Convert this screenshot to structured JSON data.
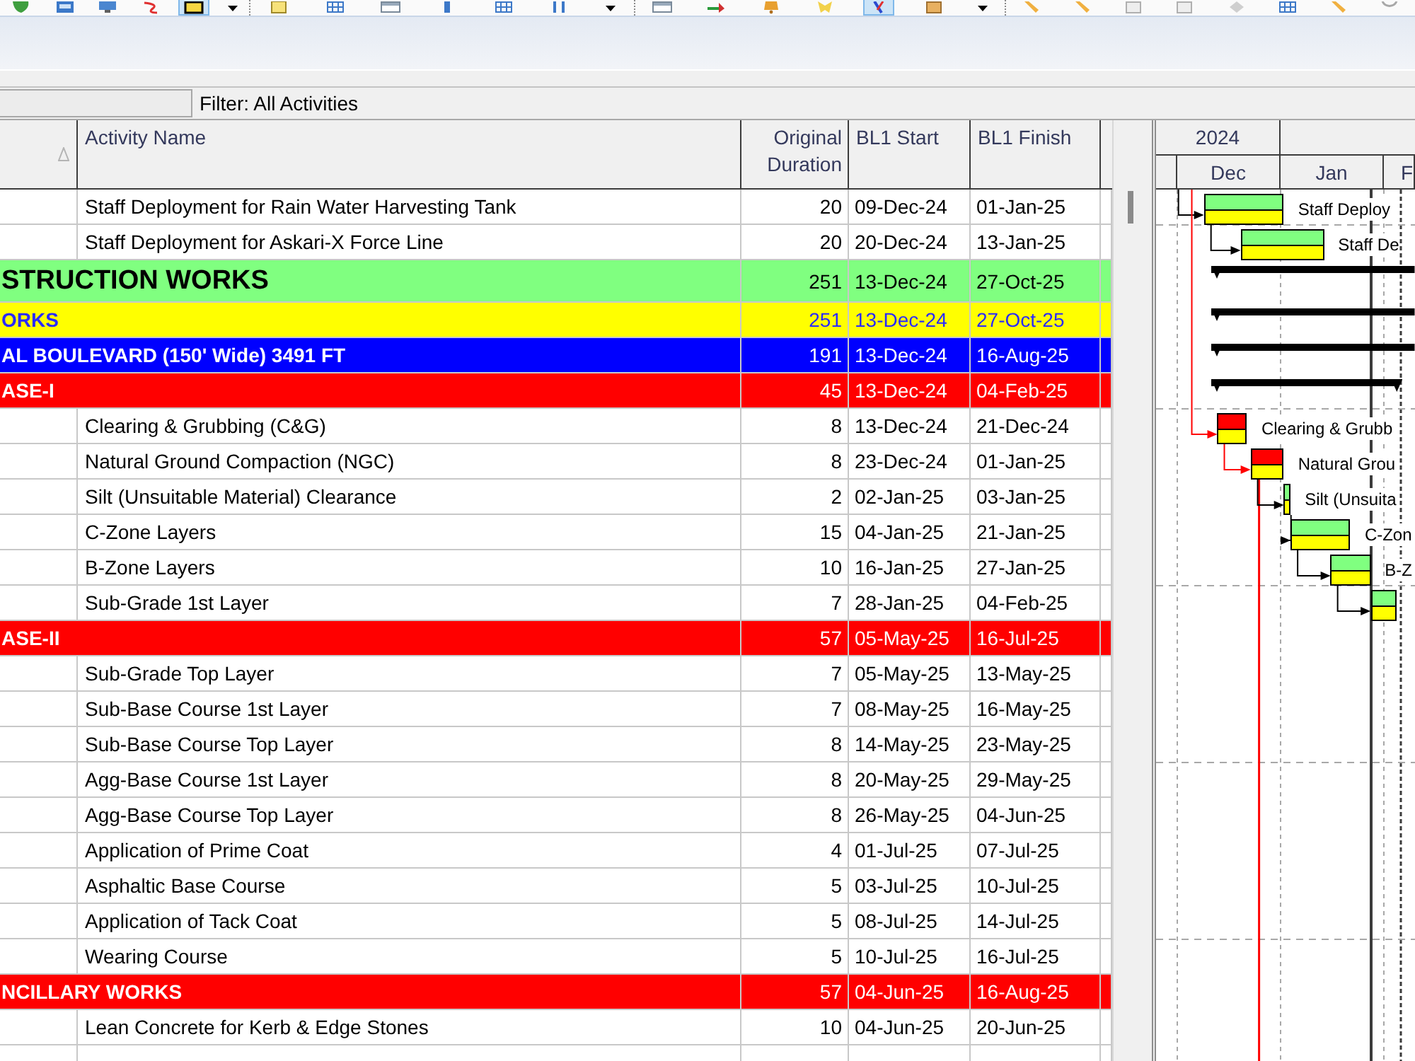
{
  "toolbar": {
    "groups": [
      {
        "buttons": [
          {
            "kind": "leaf",
            "selected": false
          },
          {
            "kind": "tile",
            "selected": false
          },
          {
            "kind": "monitor",
            "selected": false
          },
          {
            "kind": "curve",
            "selected": false
          },
          {
            "kind": "frame",
            "selected": true
          },
          {
            "kind": "caret",
            "selected": false
          }
        ]
      },
      {
        "buttons": [
          {
            "kind": "note",
            "selected": false
          },
          {
            "kind": "grid",
            "selected": false
          },
          {
            "kind": "window",
            "selected": false
          },
          {
            "kind": "bar",
            "selected": false
          },
          {
            "kind": "grid",
            "selected": false
          },
          {
            "kind": "lines",
            "selected": false
          },
          {
            "kind": "caret",
            "selected": false
          }
        ]
      },
      {
        "buttons": [
          {
            "kind": "window",
            "selected": false
          },
          {
            "kind": "swap",
            "selected": false
          },
          {
            "kind": "bell",
            "selected": false
          },
          {
            "kind": "star",
            "selected": false
          },
          {
            "kind": "pin",
            "selected": true
          },
          {
            "kind": "box",
            "selected": false
          },
          {
            "kind": "caret",
            "selected": false
          }
        ]
      },
      {
        "buttons": [
          {
            "kind": "pencil",
            "selected": false
          },
          {
            "kind": "pencil",
            "selected": false
          },
          {
            "kind": "square",
            "selected": false
          },
          {
            "kind": "square",
            "selected": false
          },
          {
            "kind": "diamond",
            "selected": false
          },
          {
            "kind": "grid",
            "selected": false
          },
          {
            "kind": "pencil",
            "selected": false
          },
          {
            "kind": "circle",
            "selected": false
          }
        ]
      }
    ]
  },
  "filter": {
    "label": "Filter: All Activities"
  },
  "table": {
    "columns": [
      {
        "kind": "id",
        "sorted": true
      },
      {
        "kind": "name",
        "label": "Activity Name"
      },
      {
        "kind": "duration",
        "label": "Original Duration"
      },
      {
        "kind": "date",
        "label": "BL1 Start"
      },
      {
        "kind": "date",
        "label": "BL1 Finish"
      }
    ],
    "rows": [
      {
        "kind": "activity",
        "name": "Staff Deployment for Rain Water Harvesting Tank",
        "duration": "20",
        "start": "09-Dec-24",
        "finish": "01-Jan-25",
        "critical": false,
        "bar_label": "Staff Deploy"
      },
      {
        "kind": "activity",
        "name": "Staff Deployment for Askari-X Force Line",
        "duration": "20",
        "start": "20-Dec-24",
        "finish": "13-Jan-25",
        "critical": false,
        "bar_label": "Staff De"
      },
      {
        "kind": "wbs",
        "name": "STRUCTION WORKS",
        "duration": "251",
        "start": "13-Dec-24",
        "finish": "27-Oct-25",
        "color": "#80ff80",
        "children": [
          {
            "kind": "wbs",
            "name": "ORKS",
            "duration": "251",
            "start": "13-Dec-24",
            "finish": "27-Oct-25",
            "color": "#ffff00",
            "children": [
              {
                "kind": "wbs",
                "name": "AL BOULEVARD (150' Wide) 3491 FT",
                "duration": "191",
                "start": "13-Dec-24",
                "finish": "16-Aug-25",
                "color": "#0000ff",
                "children": [
                  {
                    "kind": "wbs",
                    "name": "ASE-I",
                    "duration": "45",
                    "start": "13-Dec-24",
                    "finish": "04-Feb-25",
                    "color": "#ff0000",
                    "children": [
                      {
                        "kind": "activity",
                        "name": "Clearing & Grubbing (C&G)",
                        "duration": "8",
                        "start": "13-Dec-24",
                        "finish": "21-Dec-24",
                        "critical": true,
                        "bar_label": "Clearing & Grubb"
                      },
                      {
                        "kind": "activity",
                        "name": "Natural Ground Compaction (NGC)",
                        "duration": "8",
                        "start": "23-Dec-24",
                        "finish": "01-Jan-25",
                        "critical": true,
                        "bar_label": "Natural Grou",
                        "link_below": true
                      },
                      {
                        "kind": "activity",
                        "name": "Silt (Unsuitable Material) Clearance",
                        "duration": "2",
                        "start": "02-Jan-25",
                        "finish": "03-Jan-25",
                        "critical": false,
                        "bar_label": "Silt (Unsuita"
                      },
                      {
                        "kind": "activity",
                        "name": "C-Zone Layers",
                        "duration": "15",
                        "start": "04-Jan-25",
                        "finish": "21-Jan-25",
                        "critical": false,
                        "bar_label": "C-Zon"
                      },
                      {
                        "kind": "activity",
                        "name": "B-Zone Layers",
                        "duration": "10",
                        "start": "16-Jan-25",
                        "finish": "27-Jan-25",
                        "critical": false,
                        "bar_label": "B-Z"
                      },
                      {
                        "kind": "activity",
                        "name": "Sub-Grade 1st Layer",
                        "duration": "7",
                        "start": "28-Jan-25",
                        "finish": "04-Feb-25",
                        "critical": false
                      }
                    ]
                  },
                  {
                    "kind": "wbs",
                    "name": "ASE-II",
                    "duration": "57",
                    "start": "05-May-25",
                    "finish": "16-Jul-25",
                    "color": "#ff0000",
                    "children": [
                      {
                        "kind": "activity",
                        "name": "Sub-Grade Top Layer",
                        "duration": "7",
                        "start": "05-May-25",
                        "finish": "13-May-25"
                      },
                      {
                        "kind": "activity",
                        "name": "Sub-Base Course 1st Layer",
                        "duration": "7",
                        "start": "08-May-25",
                        "finish": "16-May-25"
                      },
                      {
                        "kind": "activity",
                        "name": "Sub-Base Course Top Layer",
                        "duration": "8",
                        "start": "14-May-25",
                        "finish": "23-May-25"
                      },
                      {
                        "kind": "activity",
                        "name": "Agg-Base Course 1st Layer",
                        "duration": "8",
                        "start": "20-May-25",
                        "finish": "29-May-25"
                      },
                      {
                        "kind": "activity",
                        "name": "Agg-Base Course Top Layer",
                        "duration": "8",
                        "start": "26-May-25",
                        "finish": "04-Jun-25"
                      },
                      {
                        "kind": "activity",
                        "name": "Application of Prime Coat",
                        "duration": "4",
                        "start": "01-Jul-25",
                        "finish": "07-Jul-25"
                      },
                      {
                        "kind": "activity",
                        "name": "Asphaltic Base Course",
                        "duration": "5",
                        "start": "03-Jul-25",
                        "finish": "10-Jul-25"
                      },
                      {
                        "kind": "activity",
                        "name": "Application of Tack Coat",
                        "duration": "5",
                        "start": "08-Jul-25",
                        "finish": "14-Jul-25"
                      },
                      {
                        "kind": "activity",
                        "name": "Wearing Course",
                        "duration": "5",
                        "start": "10-Jul-25",
                        "finish": "16-Jul-25"
                      }
                    ]
                  },
                  {
                    "kind": "wbs",
                    "name": "NCILLARY WORKS",
                    "duration": "57",
                    "start": "04-Jun-25",
                    "finish": "16-Aug-25",
                    "color": "#ff0000",
                    "children": [
                      {
                        "kind": "activity",
                        "name": "Lean Concrete for Kerb & Edge Stones",
                        "duration": "10",
                        "start": "04-Jun-25",
                        "finish": "20-Jun-25"
                      }
                    ]
                  }
                ]
              }
            ]
          }
        ]
      }
    ]
  },
  "gantt": {
    "years": [
      {
        "label": "2024"
      }
    ],
    "months": [
      {
        "label": "Dec"
      },
      {
        "label": "Jan"
      },
      {
        "label": "F"
      }
    ]
  }
}
